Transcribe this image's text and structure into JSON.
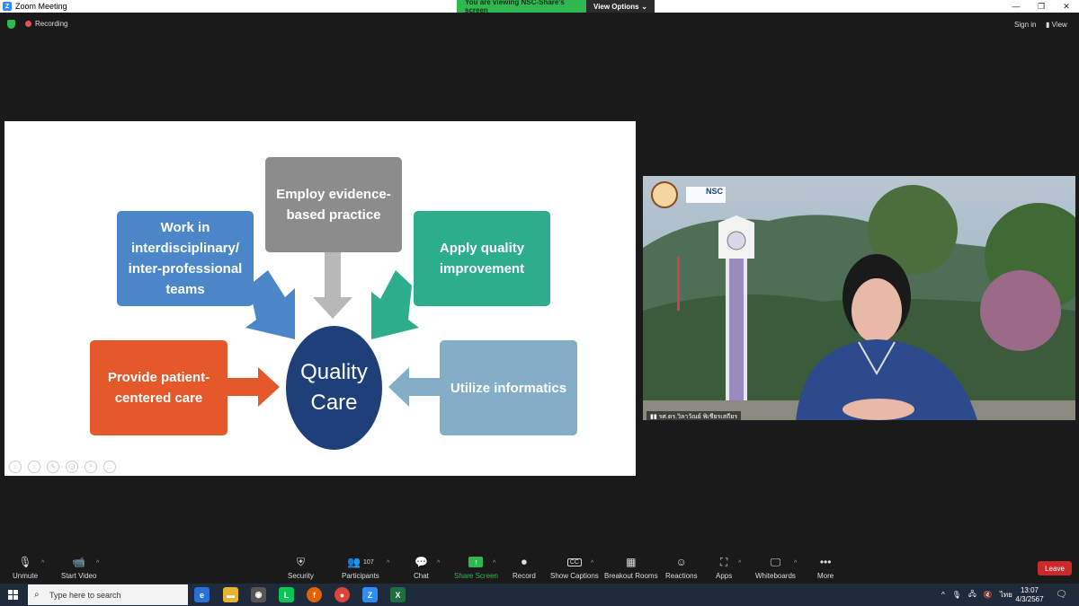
{
  "window": {
    "title": "Zoom Meeting",
    "min": "—",
    "restore": "❐",
    "close": "✕"
  },
  "banner": {
    "viewing": "You are viewing NSC-Share's screen",
    "view_options": "View Options",
    "caret": "⌄"
  },
  "status": {
    "recording": "Recording",
    "sign_in": "Sign in",
    "view": "View"
  },
  "slide": {
    "center": "Quality Care",
    "boxes": {
      "ebp": "Employ evidence-based practice",
      "team": "Work in interdisciplinary/ inter-professional teams",
      "qi": "Apply quality improvement",
      "pcc": "Provide patient-centered care",
      "inf": "Utilize informatics"
    },
    "colors": {
      "ebp": "#8c8c8c",
      "team": "#4a86c8",
      "qi": "#2cad8c",
      "pcc": "#e5582a",
      "inf": "#84aec6",
      "center": "#1e3f78"
    }
  },
  "video": {
    "name": "รศ.ดร.วิลาวัณย์ พิเชียรเสถียร",
    "logo_text": "NSC"
  },
  "toolbar": {
    "unmute": "Unmute",
    "start_video": "Start Video",
    "security": "Security",
    "participants": "Participants",
    "participants_count": "107",
    "chat": "Chat",
    "share_screen": "Share Screen",
    "record": "Record",
    "show_captions": "Show Captions",
    "breakout_rooms": "Breakout Rooms",
    "reactions": "Reactions",
    "apps": "Apps",
    "whiteboards": "Whiteboards",
    "more": "More",
    "leave": "Leave",
    "captions_icon": "CC",
    "caret": "^"
  },
  "taskbar": {
    "search_placeholder": "Type here to search",
    "lang": "ไทย",
    "time": "13:07",
    "date": "4/3/2567"
  }
}
